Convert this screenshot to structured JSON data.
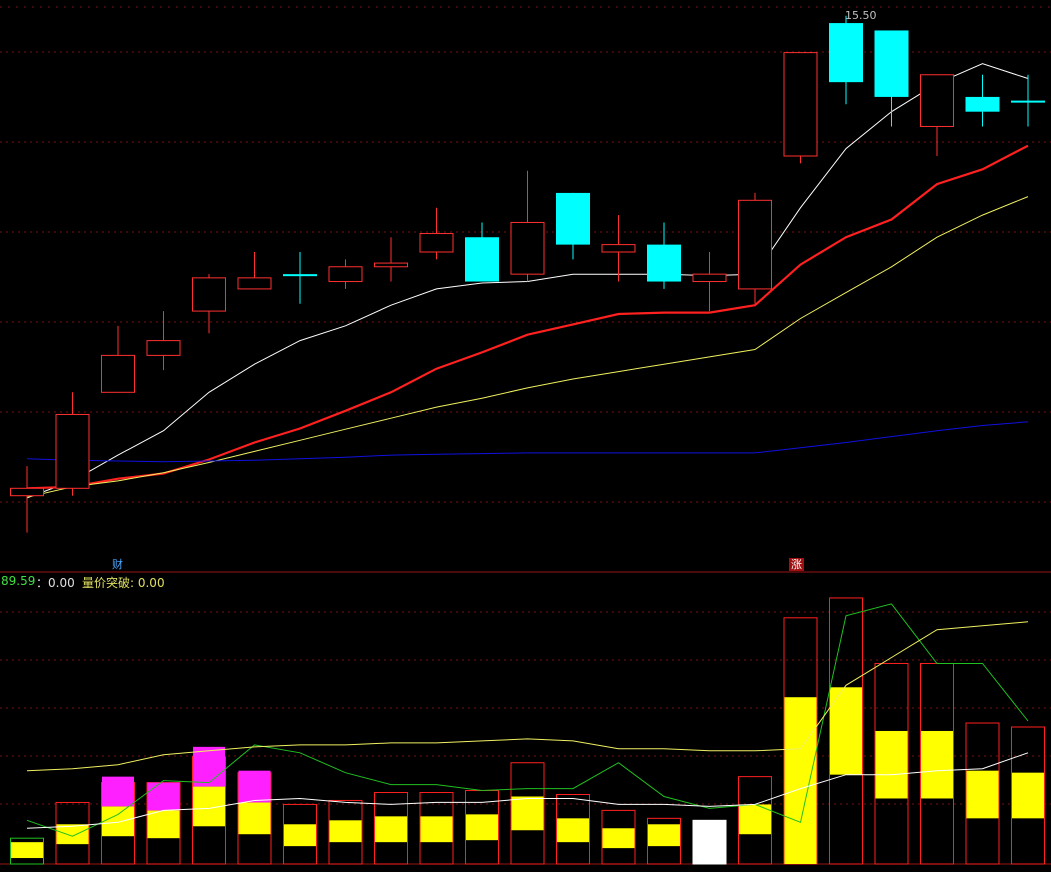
{
  "chart_data": [
    {
      "type": "candlestick",
      "peak_label": "15.50",
      "markers": {
        "left": "财",
        "right": "涨"
      },
      "candles": [
        {
          "o": 9.0,
          "h": 9.4,
          "l": 8.5,
          "c": 9.1,
          "color": "red"
        },
        {
          "o": 9.1,
          "h": 10.4,
          "l": 9.0,
          "c": 10.1,
          "color": "red"
        },
        {
          "o": 10.4,
          "h": 11.3,
          "l": 10.4,
          "c": 10.9,
          "color": "red"
        },
        {
          "o": 10.9,
          "h": 11.5,
          "l": 10.7,
          "c": 11.1,
          "color": "red"
        },
        {
          "o": 11.5,
          "h": 12.0,
          "l": 11.2,
          "c": 11.95,
          "color": "red"
        },
        {
          "o": 11.8,
          "h": 12.3,
          "l": 11.8,
          "c": 11.95,
          "color": "red"
        },
        {
          "o": 12.0,
          "h": 12.3,
          "l": 11.6,
          "c": 12.0,
          "color": "cyan"
        },
        {
          "o": 11.9,
          "h": 12.2,
          "l": 11.8,
          "c": 12.1,
          "color": "red"
        },
        {
          "o": 12.1,
          "h": 12.5,
          "l": 11.9,
          "c": 12.15,
          "color": "red"
        },
        {
          "o": 12.3,
          "h": 12.9,
          "l": 12.2,
          "c": 12.55,
          "color": "red"
        },
        {
          "o": 12.5,
          "h": 12.7,
          "l": 11.9,
          "c": 11.9,
          "color": "cyan"
        },
        {
          "o": 12.0,
          "h": 13.4,
          "l": 11.9,
          "c": 12.7,
          "color": "red"
        },
        {
          "o": 13.1,
          "h": 13.1,
          "l": 12.2,
          "c": 12.4,
          "color": "cyan"
        },
        {
          "o": 12.3,
          "h": 12.8,
          "l": 11.9,
          "c": 12.4,
          "color": "red"
        },
        {
          "o": 12.4,
          "h": 12.7,
          "l": 11.8,
          "c": 11.9,
          "color": "cyan"
        },
        {
          "o": 11.9,
          "h": 12.3,
          "l": 11.5,
          "c": 12.0,
          "color": "red"
        },
        {
          "o": 11.8,
          "h": 13.1,
          "l": 11.6,
          "c": 13.0,
          "color": "red"
        },
        {
          "o": 13.6,
          "h": 15.0,
          "l": 13.5,
          "c": 15.0,
          "color": "red"
        },
        {
          "o": 15.4,
          "h": 15.5,
          "l": 14.3,
          "c": 14.6,
          "color": "cyan"
        },
        {
          "o": 15.3,
          "h": 15.3,
          "l": 14.0,
          "c": 14.4,
          "color": "cyan"
        },
        {
          "o": 14.7,
          "h": 14.7,
          "l": 13.6,
          "c": 14.0,
          "color": "red"
        },
        {
          "o": 14.4,
          "h": 14.7,
          "l": 14.0,
          "c": 14.2,
          "color": "cyan"
        },
        {
          "o": 14.35,
          "h": 14.7,
          "l": 14.0,
          "c": 14.35,
          "color": "cyan"
        }
      ],
      "ma_series": [
        {
          "color": "#ffffff",
          "values": [
            8.97,
            9.2,
            9.55,
            9.88,
            10.4,
            10.78,
            11.1,
            11.3,
            11.58,
            11.8,
            11.88,
            11.9,
            12.0,
            12.0,
            12.0,
            11.98,
            12.0,
            12.9,
            13.7,
            14.2,
            14.58,
            14.85,
            14.65
          ]
        },
        {
          "color": "#ff2020",
          "values": [
            9.1,
            9.12,
            9.23,
            9.3,
            9.49,
            9.72,
            9.91,
            10.15,
            10.4,
            10.72,
            10.94,
            11.18,
            11.32,
            11.46,
            11.48,
            11.48,
            11.58,
            12.13,
            12.5,
            12.74,
            13.22,
            13.42,
            13.74
          ]
        },
        {
          "color": "#f0f060",
          "values": [
            8.98,
            9.12,
            9.2,
            9.31,
            9.45,
            9.6,
            9.75,
            9.9,
            10.05,
            10.2,
            10.32,
            10.46,
            10.58,
            10.68,
            10.78,
            10.88,
            10.98,
            11.4,
            11.75,
            12.1,
            12.5,
            12.8,
            13.05
          ]
        },
        {
          "color": "#1010e0",
          "values": [
            9.5,
            9.48,
            9.47,
            9.46,
            9.47,
            9.48,
            9.5,
            9.52,
            9.55,
            9.56,
            9.57,
            9.58,
            9.58,
            9.58,
            9.58,
            9.58,
            9.58,
            9.65,
            9.72,
            9.8,
            9.88,
            9.95,
            10.0
          ]
        }
      ]
    },
    {
      "type": "bar",
      "indicator_labels": {
        "value": "89.59",
        "sep": "：0.00",
        "name": "量价突破: 0.00"
      },
      "bars": [
        {
          "outline": "#20c020",
          "total": 13,
          "yellow": 8,
          "yellow_base": 3,
          "magenta": 0
        },
        {
          "outline": "#ff2020",
          "total": 31,
          "yellow": 10,
          "yellow_base": 10,
          "magenta": 0
        },
        {
          "outline": "#ff2020",
          "total": 41,
          "yellow": 15,
          "yellow_base": 14,
          "magenta": 15
        },
        {
          "outline": "#ff2020",
          "total": 41,
          "yellow": 14,
          "yellow_base": 13,
          "magenta": 14
        },
        {
          "outline": "#ff2020",
          "total": 54,
          "yellow": 20,
          "yellow_base": 19,
          "magenta": 20
        },
        {
          "outline": "#ff2020",
          "total": 46,
          "yellow": 16,
          "yellow_base": 15,
          "magenta": 16
        },
        {
          "outline": "#ff2020",
          "total": 30,
          "yellow": 11,
          "yellow_base": 9,
          "magenta": 0
        },
        {
          "outline": "#ff2020",
          "total": 32,
          "yellow": 11,
          "yellow_base": 11,
          "magenta": 0
        },
        {
          "outline": "#ff2020",
          "total": 36,
          "yellow": 13,
          "yellow_base": 11,
          "magenta": 0
        },
        {
          "outline": "#ff2020",
          "total": 36,
          "yellow": 13,
          "yellow_base": 11,
          "magenta": 0
        },
        {
          "outline": "#ff2020",
          "total": 37,
          "yellow": 13,
          "yellow_base": 12,
          "magenta": 0
        },
        {
          "outline": "#ff2020",
          "total": 51,
          "yellow": 17,
          "yellow_base": 17,
          "magenta": 0
        },
        {
          "outline": "#ff2020",
          "total": 35,
          "yellow": 12,
          "yellow_base": 11,
          "magenta": 0
        },
        {
          "outline": "#ff2020",
          "total": 27,
          "yellow": 10,
          "yellow_base": 8,
          "magenta": 0
        },
        {
          "outline": "#ff2020",
          "total": 23,
          "yellow": 11,
          "yellow_base": 9,
          "magenta": 0
        },
        {
          "outline": "#ffffff",
          "total": 22,
          "yellow": 0,
          "yellow_base": 0,
          "magenta": 0,
          "fill": "#ffffff"
        },
        {
          "outline": "#ff2020",
          "total": 44,
          "yellow": 15,
          "yellow_base": 15,
          "magenta": 0
        },
        {
          "outline": "#ff2020",
          "total": 124,
          "yellow": 84,
          "yellow_base": 0,
          "magenta": 0
        },
        {
          "outline": "#ff2020",
          "total": 134,
          "yellow": 44,
          "yellow_base": 45,
          "magenta": 0
        },
        {
          "outline": "#ff2020",
          "total": 101,
          "yellow": 34,
          "yellow_base": 33,
          "magenta": 0
        },
        {
          "outline": "#ff2020",
          "total": 101,
          "yellow": 34,
          "yellow_base": 33,
          "magenta": 0
        },
        {
          "outline": "#ff2020",
          "total": 71,
          "yellow": 24,
          "yellow_base": 23,
          "magenta": 0
        },
        {
          "outline": "#ff2020",
          "total": 69,
          "yellow": 23,
          "yellow_base": 23,
          "magenta": 0
        }
      ],
      "lines": [
        {
          "color": "#20c020",
          "values": [
            22,
            14,
            25,
            42,
            41,
            60,
            56,
            46,
            40,
            40,
            37,
            38,
            38,
            51,
            34,
            28,
            30,
            21,
            125,
            131,
            101,
            101,
            72
          ]
        },
        {
          "color": "#ffffff",
          "values": [
            18,
            19,
            21,
            27,
            28,
            32,
            33,
            31,
            30,
            31,
            31,
            33,
            33,
            30,
            30,
            29,
            30,
            38,
            45,
            45,
            47,
            48,
            56
          ]
        },
        {
          "color": "#f0f060",
          "values": [
            47,
            48,
            50,
            55,
            57,
            59,
            60,
            60,
            61,
            61,
            62,
            63,
            62,
            58,
            58,
            57,
            57,
            58,
            90,
            104,
            118,
            120,
            122
          ]
        }
      ]
    }
  ]
}
